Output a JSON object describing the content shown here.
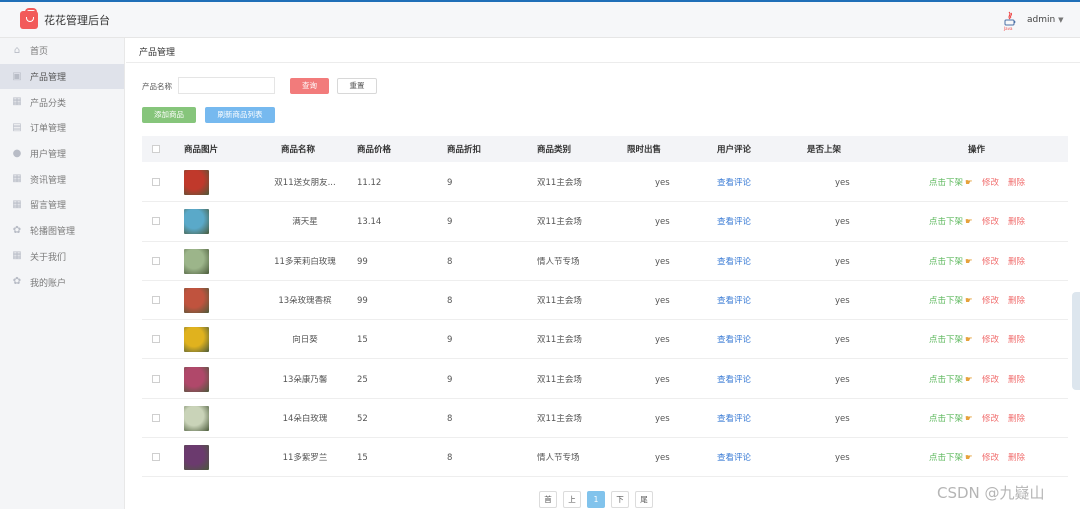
{
  "app": {
    "title": "花花管理后台",
    "user": "admin"
  },
  "sidebar": {
    "items": [
      {
        "label": "首页",
        "icon": "home-icon"
      },
      {
        "label": "产品管理",
        "icon": "product-icon",
        "active": true
      },
      {
        "label": "产品分类",
        "icon": "grid-icon"
      },
      {
        "label": "订单管理",
        "icon": "clipboard-icon"
      },
      {
        "label": "用户管理",
        "icon": "user-icon"
      },
      {
        "label": "资讯管理",
        "icon": "grid-icon"
      },
      {
        "label": "留言管理",
        "icon": "grid-icon"
      },
      {
        "label": "轮播图管理",
        "icon": "gear-icon"
      },
      {
        "label": "关于我们",
        "icon": "grid-icon"
      },
      {
        "label": "我的账户",
        "icon": "gear-icon"
      }
    ]
  },
  "breadcrumb": "产品管理",
  "search": {
    "label": "产品名称",
    "value": "",
    "query_label": "查询",
    "reset_label": "重置"
  },
  "actions": {
    "add_label": "添加商品",
    "refresh_label": "刷新商品列表"
  },
  "table": {
    "headers": [
      "商品图片",
      "商品名称",
      "商品价格",
      "商品折扣",
      "商品类别",
      "限时出售",
      "用户评论",
      "是否上架",
      "操作"
    ],
    "rows": [
      {
        "name": "双11送女朋友...",
        "price": "11.12",
        "discount": "9",
        "category": "双11主会场",
        "limited": "yes",
        "comment": "查看评论",
        "listed": "yes",
        "thumb": "#c0392b"
      },
      {
        "name": "满天星",
        "price": "13.14",
        "discount": "9",
        "category": "双11主会场",
        "limited": "yes",
        "comment": "查看评论",
        "listed": "yes",
        "thumb": "#5aa9c9"
      },
      {
        "name": "11多茉莉白玫瑰",
        "price": "99",
        "discount": "8",
        "category": "情人节专场",
        "limited": "yes",
        "comment": "查看评论",
        "listed": "yes",
        "thumb": "#9cb58a"
      },
      {
        "name": "13朵玫瑰香槟",
        "price": "99",
        "discount": "8",
        "category": "双11主会场",
        "limited": "yes",
        "comment": "查看评论",
        "listed": "yes",
        "thumb": "#c0533e"
      },
      {
        "name": "向日葵",
        "price": "15",
        "discount": "9",
        "category": "双11主会场",
        "limited": "yes",
        "comment": "查看评论",
        "listed": "yes",
        "thumb": "#e0b21e"
      },
      {
        "name": "13朵康乃馨",
        "price": "25",
        "discount": "9",
        "category": "双11主会场",
        "limited": "yes",
        "comment": "查看评论",
        "listed": "yes",
        "thumb": "#b0486a"
      },
      {
        "name": "14朵白玫瑰",
        "price": "52",
        "discount": "8",
        "category": "双11主会场",
        "limited": "yes",
        "comment": "查看评论",
        "listed": "yes",
        "thumb": "#c9d3b8"
      },
      {
        "name": "11多紫罗兰",
        "price": "15",
        "discount": "8",
        "category": "情人节专场",
        "limited": "yes",
        "comment": "查看评论",
        "listed": "yes",
        "thumb": "#6b3a6e"
      }
    ],
    "ops": {
      "takedown": "点击下架",
      "edit": "修改",
      "delete": "删除"
    }
  },
  "pagination": {
    "first": "首",
    "prev": "上",
    "current": "1",
    "next": "下",
    "last": "尾"
  },
  "watermark": "CSDN @九嶷山"
}
